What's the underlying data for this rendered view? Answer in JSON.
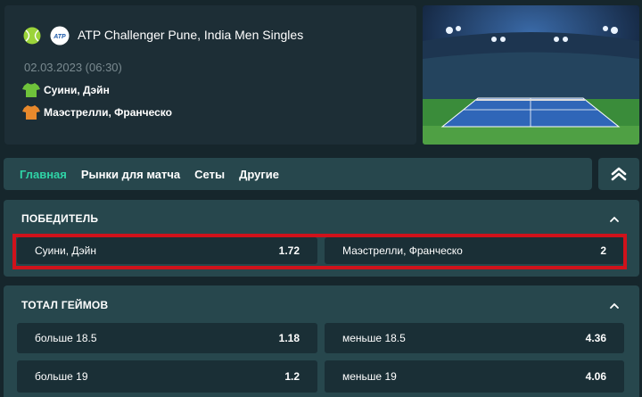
{
  "event": {
    "title": "ATP Challenger Pune, India Men Singles",
    "date": "02.03.2023 (06:30)",
    "players": [
      {
        "name": "Суини, Дэйн",
        "shirt_color": "#6fc33b"
      },
      {
        "name": "Маэстрелли, Франческо",
        "shirt_color": "#e8892c"
      }
    ],
    "icons": {
      "sport": "tennis-ball-icon",
      "league": "atp-logo-icon"
    }
  },
  "tabs": [
    {
      "label": "Главная",
      "active": true
    },
    {
      "label": "Рынки для матча",
      "active": false
    },
    {
      "label": "Сеты",
      "active": false
    },
    {
      "label": "Другие",
      "active": false
    }
  ],
  "markets": {
    "winner": {
      "title": "ПОБЕДИТЕЛЬ",
      "odds": [
        {
          "label": "Суини, Дэйн",
          "value": "1.72"
        },
        {
          "label": "Маэстрелли, Франческо",
          "value": "2"
        }
      ]
    },
    "total_games": {
      "title": "ТОТАЛ ГЕЙМОВ",
      "rows": [
        [
          {
            "label": "больше 18.5",
            "value": "1.18"
          },
          {
            "label": "меньше 18.5",
            "value": "4.36"
          }
        ],
        [
          {
            "label": "больше 19",
            "value": "1.2"
          },
          {
            "label": "меньше 19",
            "value": "4.06"
          }
        ]
      ]
    }
  },
  "colors": {
    "background": "#16262c",
    "panel": "#27474d",
    "accent": "#2fd3a6",
    "highlight": "#d0121b"
  }
}
